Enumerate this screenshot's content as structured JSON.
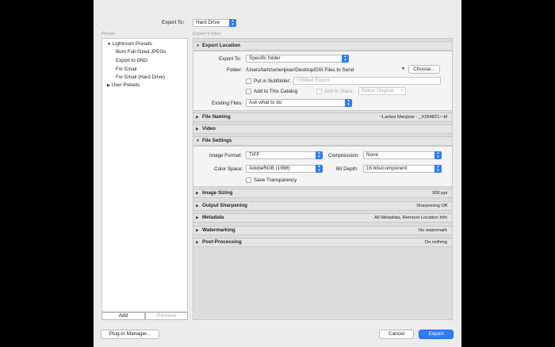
{
  "header": {
    "export_to_label": "Export To:",
    "export_to_value": "Hard Drive"
  },
  "left": {
    "title": "Preset:",
    "groups": [
      {
        "label": "Lightroom Presets",
        "items": [
          "Burn Full-Sized JPEGs",
          "Export to DNG",
          "For Email",
          "For Email (Hard Drive)"
        ]
      },
      {
        "label": "User Presets",
        "items": []
      }
    ],
    "add_label": "Add",
    "remove_label": "Remove"
  },
  "right_title": "Export 6 Files",
  "export_location": {
    "title": "Export Location",
    "export_to_label": "Export To:",
    "export_to_value": "Specific folder",
    "folder_label": "Folder:",
    "folder_value": "/Users/laritzamenjivar/Desktop/DSI Files to Send",
    "choose_label": "Choose...",
    "subfolder_label": "Put in Subfolder:",
    "subfolder_placeholder": "Untitled Export",
    "catalog_label": "Add to This Catalog",
    "stack_label": "Add to Stack:",
    "stack_value": "Below Original",
    "existing_label": "Existing Files:",
    "existing_value": "Ask what to do"
  },
  "file_naming": {
    "title": "File Naming",
    "summary": "~Laritza Menjivar - _X284821~.tif"
  },
  "video": {
    "title": "Video"
  },
  "file_settings": {
    "title": "File Settings",
    "format_label": "Image Format:",
    "format_value": "TIFF",
    "compression_label": "Compression:",
    "compression_value": "None",
    "colorspace_label": "Color Space:",
    "colorspace_value": "AdobeRGB (1998)",
    "bitdepth_label": "Bit Depth:",
    "bitdepth_value": "16 bits/component",
    "transparency_label": "Save Transparency"
  },
  "image_sizing": {
    "title": "Image Sizing",
    "summary": "300 ppi"
  },
  "output_sharpening": {
    "title": "Output Sharpening",
    "summary": "Sharpening Off"
  },
  "metadata": {
    "title": "Metadata",
    "summary": "All Metadata, Remove Location Info"
  },
  "watermarking": {
    "title": "Watermarking",
    "summary": "No watermark"
  },
  "post_processing": {
    "title": "Post-Processing",
    "summary": "Do nothing"
  },
  "footer": {
    "plugin_label": "Plug-in Manager...",
    "cancel_label": "Cancel",
    "export_label": "Export"
  },
  "colors": {
    "accent": "#2f7cf6",
    "dialog_bg": "#ececec",
    "backdrop": "#000000"
  }
}
